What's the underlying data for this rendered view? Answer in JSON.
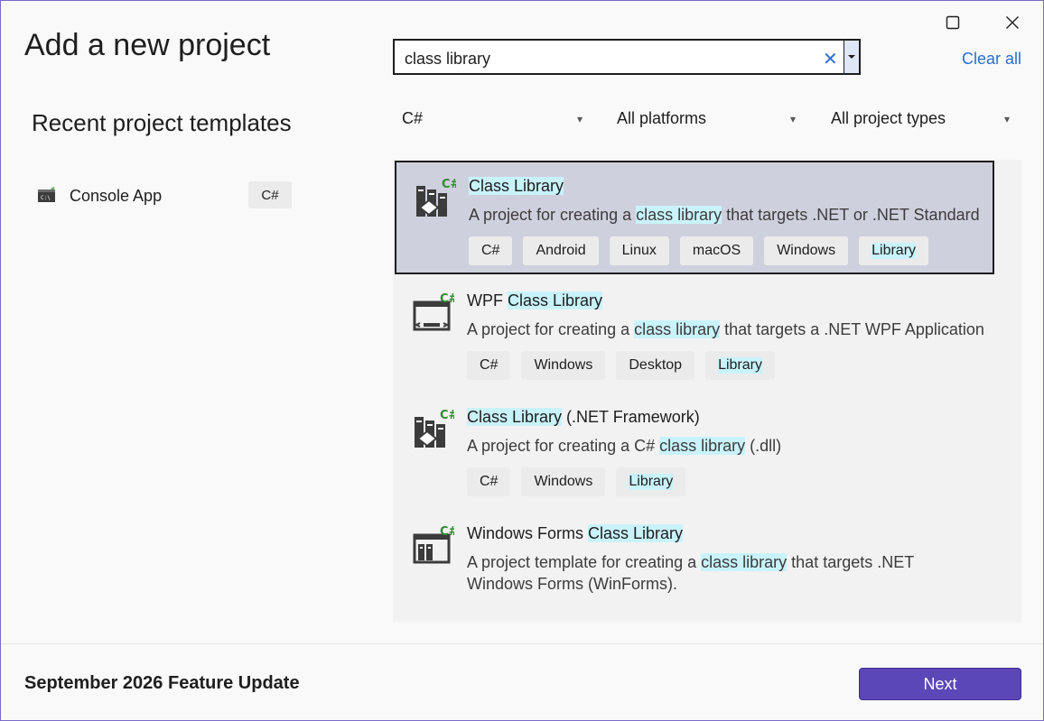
{
  "window": {
    "title": "Add a new project",
    "maximize_icon": "maximize-icon",
    "close_icon": "close-icon"
  },
  "search": {
    "value": "class library",
    "clear_glyph": "✕",
    "clear_all_label": "Clear all"
  },
  "recent": {
    "title": "Recent project templates",
    "items": [
      {
        "label": "Console App",
        "tag": "C#"
      }
    ]
  },
  "filters": {
    "language": "C#",
    "platform": "All platforms",
    "project_type": "All project types"
  },
  "templates": [
    {
      "name_plain": "",
      "name_hl": "Class Library",
      "name_rest": "",
      "desc_1": "A project for creating a ",
      "desc_hl": "class library",
      "desc_2": " that targets .NET or .NET Standard",
      "desc_line2": "",
      "tags": [
        "C#",
        "Android",
        "Linux",
        "macOS",
        "Windows"
      ],
      "tag_hl": "Library",
      "selected": true
    },
    {
      "name_plain": "WPF ",
      "name_hl": "Class Library",
      "name_rest": "",
      "desc_1": "A project for creating a ",
      "desc_hl": "class library",
      "desc_2": " that targets a .NET WPF Application",
      "desc_line2": "",
      "tags": [
        "C#",
        "Windows",
        "Desktop"
      ],
      "tag_hl": "Library",
      "selected": false
    },
    {
      "name_plain": "",
      "name_hl": "Class Library",
      "name_rest": " (.NET Framework)",
      "desc_1": "A project for creating a C# ",
      "desc_hl": "class library",
      "desc_2": " (.dll)",
      "desc_line2": "",
      "tags": [
        "C#",
        "Windows"
      ],
      "tag_hl": "Library",
      "selected": false
    },
    {
      "name_plain": "Windows Forms ",
      "name_hl": "Class Library",
      "name_rest": "",
      "desc_1": "A project template for creating a ",
      "desc_hl": "class library",
      "desc_2": " that targets .NET",
      "desc_line2": "Windows Forms (WinForms).",
      "tags": [],
      "tag_hl": "",
      "selected": false
    }
  ],
  "footer": {
    "version": "September 2026 Feature Update",
    "next_label": "Next"
  },
  "colors": {
    "accent": "#5b47b7",
    "link": "#2a6fce",
    "highlight": "#c9f3fb",
    "selected_bg": "#cfd0de",
    "csharp_badge": "#2e8b2e"
  }
}
